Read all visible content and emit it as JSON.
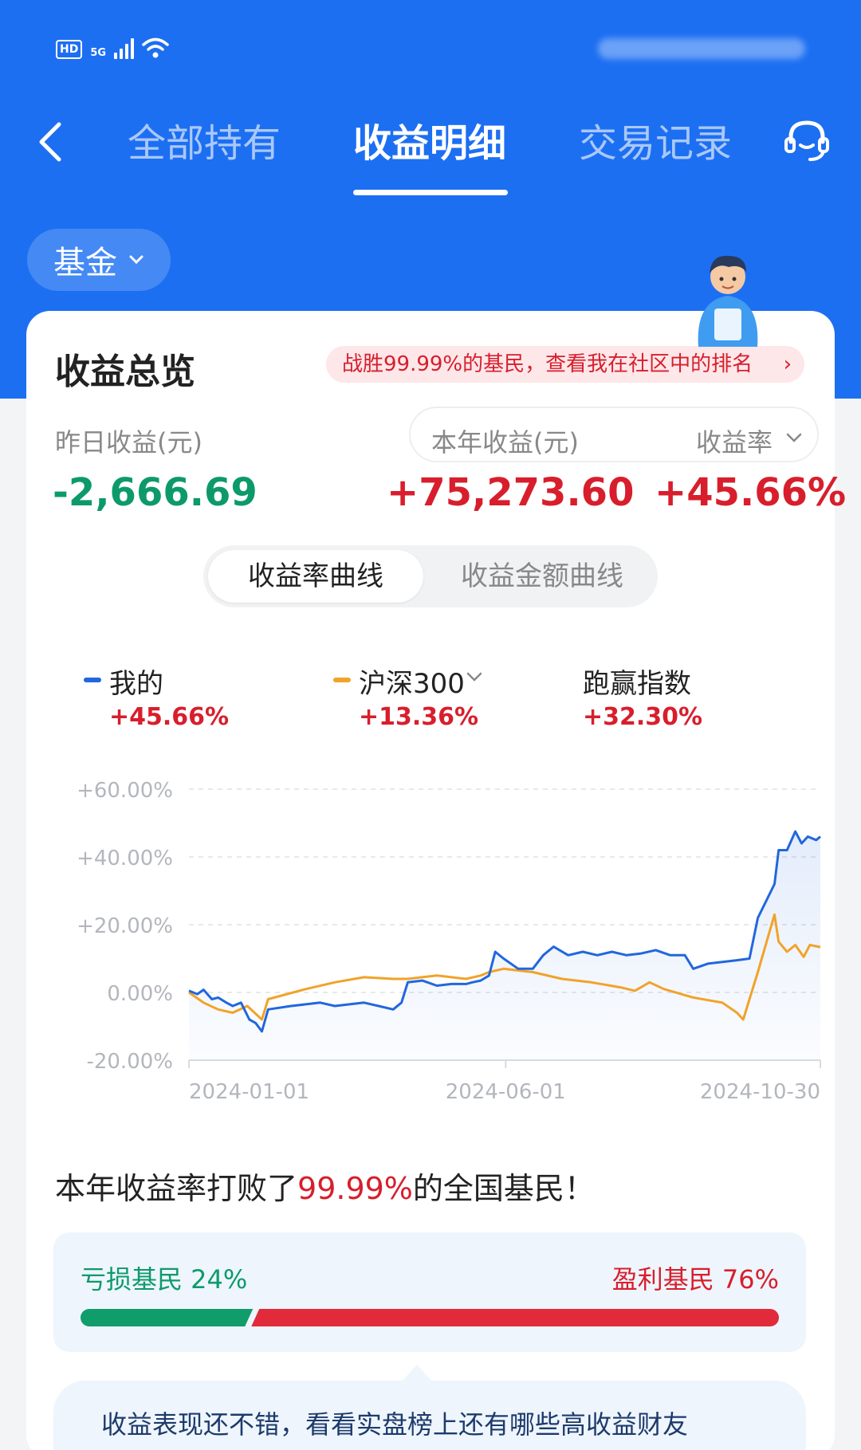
{
  "status_bar": {
    "hd": "HD",
    "network": "5G"
  },
  "nav": {
    "back_icon": "back-arrow-icon",
    "tabs": [
      {
        "label": "全部持有",
        "active": false
      },
      {
        "label": "收益明细",
        "active": true
      },
      {
        "label": "交易记录",
        "active": false
      }
    ],
    "service_icon": "customer-service-icon"
  },
  "filter": {
    "label": "基金"
  },
  "overview": {
    "title": "收益总览",
    "rank_banner": "战胜99.99%的基民，查看我在社区中的排名",
    "yesterday_label": "昨日收益(元)",
    "yesterday_value": "-2,666.69",
    "year_label": "本年收益(元)",
    "year_value": "+75,273.60",
    "rate_label": "收益率",
    "rate_value": "+45.66%"
  },
  "segmented": {
    "active": "收益率曲线",
    "inactive": "收益金额曲线"
  },
  "legend": [
    {
      "name": "我的",
      "value": "+45.66%",
      "color": "#2167dd"
    },
    {
      "name": "沪深300",
      "value": "+13.36%",
      "color": "#f0a32a"
    },
    {
      "name": "跑赢指数",
      "value": "+32.30%"
    }
  ],
  "chart_data": {
    "type": "line",
    "y_ticks": [
      "+60.00%",
      "+40.00%",
      "+20.00%",
      "0.00%",
      "-20.00%"
    ],
    "x_ticks": [
      "2024-01-01",
      "2024-06-01",
      "2024-10-30"
    ],
    "ylim": [
      -20,
      60
    ],
    "grid": true,
    "series": [
      {
        "name": "我的",
        "color": "#2167dd",
        "points": [
          [
            "2024-01-01",
            0.5
          ],
          [
            "2024-01-05",
            -0.5
          ],
          [
            "2024-01-08",
            0.8
          ],
          [
            "2024-01-12",
            -2
          ],
          [
            "2024-01-15",
            -1.5
          ],
          [
            "2024-01-19",
            -3
          ],
          [
            "2024-01-22",
            -4
          ],
          [
            "2024-01-26",
            -3
          ],
          [
            "2024-01-30",
            -8
          ],
          [
            "2024-02-02",
            -9
          ],
          [
            "2024-02-05",
            -11.5
          ],
          [
            "2024-02-08",
            -5
          ],
          [
            "2024-02-19",
            -4
          ],
          [
            "2024-02-26",
            -3.5
          ],
          [
            "2024-03-04",
            -3
          ],
          [
            "2024-03-11",
            -4
          ],
          [
            "2024-03-18",
            -3.5
          ],
          [
            "2024-03-25",
            -3
          ],
          [
            "2024-04-01",
            -4
          ],
          [
            "2024-04-08",
            -5
          ],
          [
            "2024-04-12",
            -3
          ],
          [
            "2024-04-15",
            3
          ],
          [
            "2024-04-22",
            3.5
          ],
          [
            "2024-04-29",
            2
          ],
          [
            "2024-05-06",
            2.5
          ],
          [
            "2024-05-13",
            2.5
          ],
          [
            "2024-05-16",
            3
          ],
          [
            "2024-05-20",
            3.5
          ],
          [
            "2024-05-24",
            5
          ],
          [
            "2024-05-27",
            12
          ],
          [
            "2024-05-31",
            10
          ],
          [
            "2024-06-07",
            7
          ],
          [
            "2024-06-14",
            7
          ],
          [
            "2024-06-19",
            11
          ],
          [
            "2024-06-24",
            13.5
          ],
          [
            "2024-07-01",
            11
          ],
          [
            "2024-07-08",
            12
          ],
          [
            "2024-07-15",
            11
          ],
          [
            "2024-07-22",
            12
          ],
          [
            "2024-07-29",
            11
          ],
          [
            "2024-08-05",
            11.5
          ],
          [
            "2024-08-12",
            12.5
          ],
          [
            "2024-08-19",
            11
          ],
          [
            "2024-08-26",
            11
          ],
          [
            "2024-08-30",
            7
          ],
          [
            "2024-09-06",
            8.5
          ],
          [
            "2024-09-13",
            9
          ],
          [
            "2024-09-20",
            9.5
          ],
          [
            "2024-09-26",
            10
          ],
          [
            "2024-09-30",
            22
          ],
          [
            "2024-10-08",
            32
          ],
          [
            "2024-10-10",
            42
          ],
          [
            "2024-10-14",
            42
          ],
          [
            "2024-10-18",
            47.5
          ],
          [
            "2024-10-21",
            44
          ],
          [
            "2024-10-24",
            46
          ],
          [
            "2024-10-28",
            45
          ],
          [
            "2024-10-30",
            46
          ]
        ]
      },
      {
        "name": "沪深300",
        "color": "#f0a32a",
        "points": [
          [
            "2024-01-01",
            0
          ],
          [
            "2024-01-08",
            -3
          ],
          [
            "2024-01-15",
            -5
          ],
          [
            "2024-01-22",
            -6
          ],
          [
            "2024-01-29",
            -4
          ],
          [
            "2024-02-05",
            -8
          ],
          [
            "2024-02-08",
            -2
          ],
          [
            "2024-02-26",
            1
          ],
          [
            "2024-03-11",
            3
          ],
          [
            "2024-03-25",
            4.5
          ],
          [
            "2024-04-08",
            4
          ],
          [
            "2024-04-15",
            4
          ],
          [
            "2024-04-29",
            5
          ],
          [
            "2024-05-13",
            4
          ],
          [
            "2024-05-20",
            5
          ],
          [
            "2024-05-24",
            6
          ],
          [
            "2024-05-31",
            7
          ],
          [
            "2024-06-14",
            6
          ],
          [
            "2024-06-28",
            4
          ],
          [
            "2024-07-12",
            3
          ],
          [
            "2024-07-26",
            1.5
          ],
          [
            "2024-08-02",
            0.5
          ],
          [
            "2024-08-09",
            3
          ],
          [
            "2024-08-16",
            1
          ],
          [
            "2024-08-30",
            -1.5
          ],
          [
            "2024-09-13",
            -3
          ],
          [
            "2024-09-20",
            -6
          ],
          [
            "2024-09-23",
            -8
          ],
          [
            "2024-09-26",
            -2
          ],
          [
            "2024-09-30",
            6
          ],
          [
            "2024-10-08",
            23
          ],
          [
            "2024-10-10",
            15
          ],
          [
            "2024-10-14",
            12
          ],
          [
            "2024-10-18",
            14
          ],
          [
            "2024-10-22",
            10.5
          ],
          [
            "2024-10-25",
            14
          ],
          [
            "2024-10-30",
            13.4
          ]
        ]
      }
    ]
  },
  "beat": {
    "prefix": "本年收益率打败了",
    "highlight": "99.99%",
    "suffix": "的全国基民！"
  },
  "distribution": {
    "loss_label": "亏损基民 24%",
    "gain_label": "盈利基民 76%",
    "loss_fraction": 0.24,
    "loss_color": "#119c6c",
    "gain_color": "#e12b3a"
  },
  "tip": {
    "text": "收益表现还不错，看看实盘榜上还有哪些高收益财友"
  }
}
